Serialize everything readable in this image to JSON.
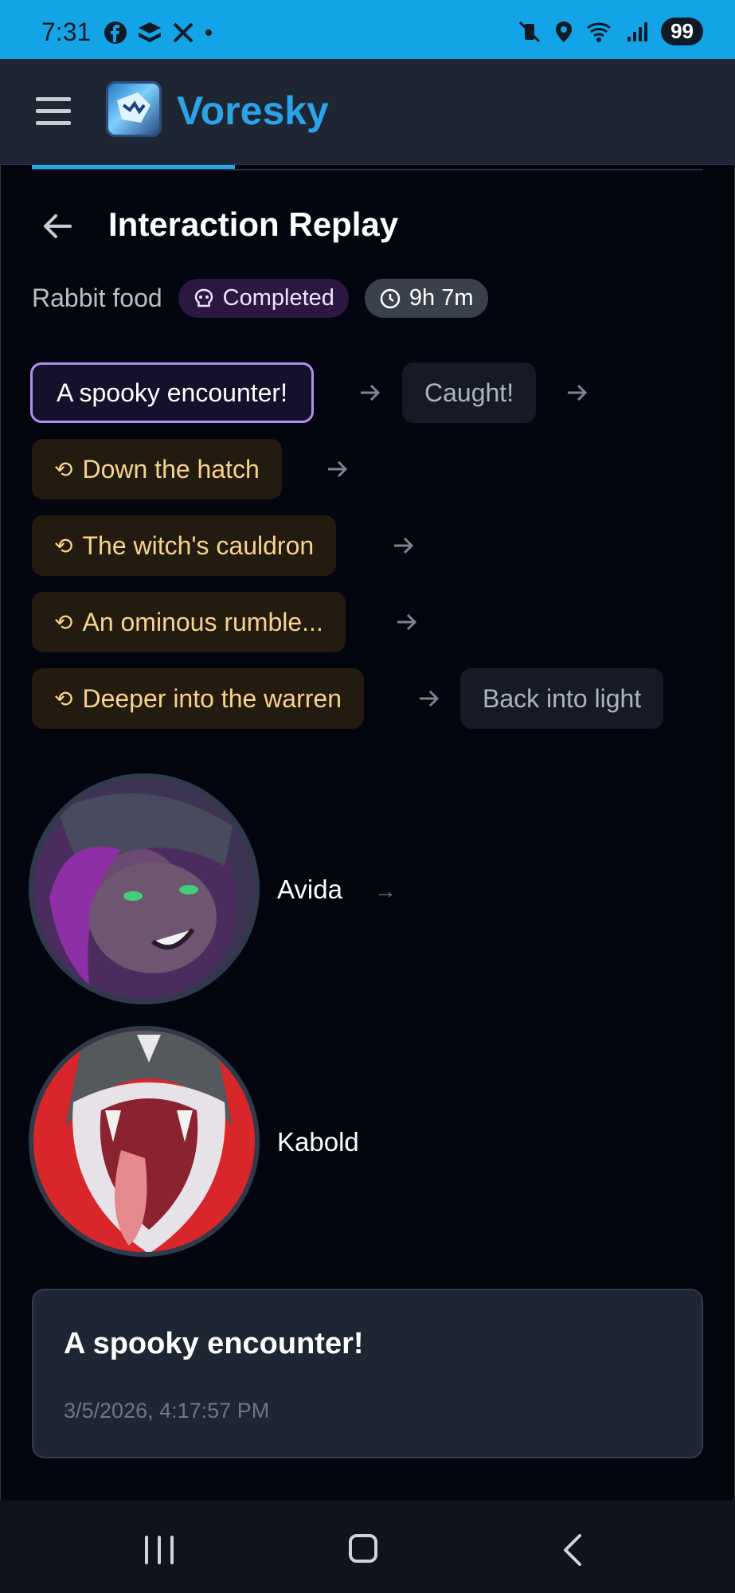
{
  "status_bar": {
    "time": "7:31",
    "left_icons": [
      "facebook-icon",
      "layers-icon",
      "x-icon",
      "dot-icon"
    ],
    "right_icons": [
      "mute-vibrate-icon",
      "location-icon",
      "wifi-6-icon",
      "signal-icon"
    ],
    "battery": "99"
  },
  "app": {
    "brand": "Voresky",
    "menu_icon": "hamburger-icon"
  },
  "page": {
    "title": "Interaction Replay",
    "back_icon": "arrow-left-icon",
    "subject": "Rabbit food",
    "status_label": "Completed",
    "status_icon": "skull-icon",
    "duration": "9h 7m",
    "duration_icon": "clock-icon"
  },
  "flow": [
    {
      "label": "A spooky encounter!",
      "kind": "current"
    },
    {
      "label": "Caught!",
      "kind": "plain"
    },
    {
      "label": "Down the hatch",
      "kind": "branch"
    },
    {
      "label": "The witch's cauldron",
      "kind": "branch"
    },
    {
      "label": "An ominous rumble...",
      "kind": "branch"
    },
    {
      "label": "Deeper into the warren",
      "kind": "branch"
    },
    {
      "label": "Back into light",
      "kind": "plain"
    }
  ],
  "characters": [
    {
      "name": "Avida",
      "arrow": "→"
    },
    {
      "name": "Kabold",
      "arrow": ""
    }
  ],
  "detail": {
    "title": "A spooky encounter!",
    "timestamp": "3/5/2026, 4:17:57 PM"
  },
  "colors": {
    "status_bar": "#12a4e6",
    "brand": "#2aa3e8",
    "current_border": "#b48df0",
    "branch_text": "#f6d48b",
    "background": "#03060f"
  }
}
